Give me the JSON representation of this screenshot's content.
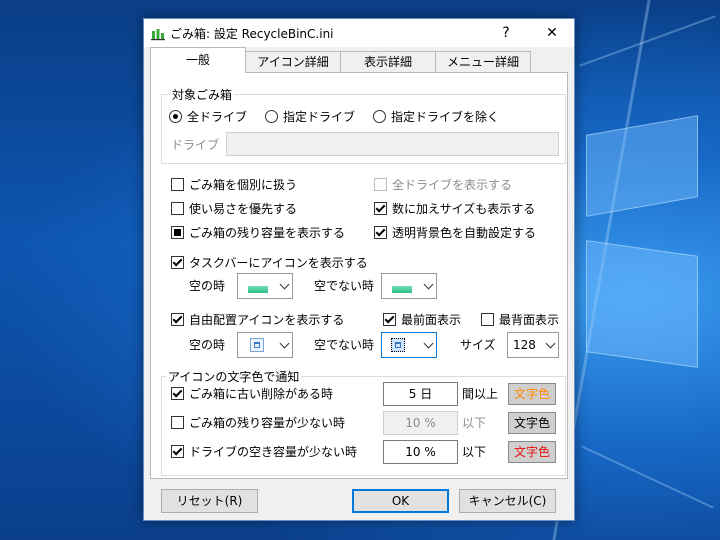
{
  "window": {
    "title": "ごみ箱: 設定  RecycleBinC.ini",
    "help_glyph": "?",
    "close_glyph": "✕"
  },
  "tabs": [
    "一般",
    "アイコン詳細",
    "表示詳細",
    "メニュー詳細"
  ],
  "target_group": {
    "label": "対象ごみ箱",
    "radio_all": "全ドライブ",
    "radio_specified": "指定ドライブ",
    "radio_exclude": "指定ドライブを除く",
    "drive_label": "ドライブ",
    "drive_value": ""
  },
  "options": {
    "individual": "ごみ箱を個別に扱う",
    "show_all_drives": "全ドライブを表示する",
    "usability": "使い易さを優先する",
    "show_size": "数に加えサイズも表示する",
    "show_remaining": "ごみ箱の残り容量を表示する",
    "auto_bg": "透明背景色を自動設定する"
  },
  "taskbar": {
    "show_icon": "タスクバーにアイコンを表示する",
    "empty_label": "空の時",
    "not_empty_label": "空でない時"
  },
  "free_icon": {
    "show_icon": "自由配置アイコンを表示する",
    "topmost": "最前面表示",
    "bottommost": "最背面表示",
    "empty_label": "空の時",
    "not_empty_label": "空でない時",
    "size_label": "サイズ",
    "size_value": "128"
  },
  "notify_group": {
    "label": "アイコンの文字色で通知",
    "rows": [
      {
        "label": "ごみ箱に古い削除がある時",
        "value": "5 日",
        "suffix": "間以上",
        "color_btn": "文字色",
        "color": "#ff8c00"
      },
      {
        "label": "ごみ箱の残り容量が少ない時",
        "value": "10 %",
        "suffix": "以下",
        "color_btn": "文字色",
        "color": "#000000"
      },
      {
        "label": "ドライブの空き容量が少ない時",
        "value": "10 %",
        "suffix": "以下",
        "color_btn": "文字色",
        "color": "#e81010"
      }
    ]
  },
  "buttons": {
    "reset": "リセット(R)",
    "ok": "OK",
    "cancel": "キャンセル(C)"
  },
  "colors": {
    "accent": "#0078d7"
  }
}
